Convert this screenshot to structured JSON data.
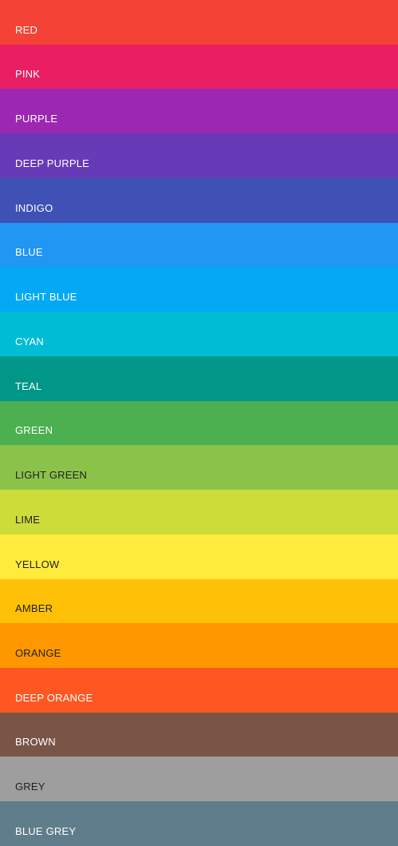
{
  "palette": {
    "items": [
      {
        "label": "RED",
        "color": "#F44336",
        "text_color": "#FFFFFF"
      },
      {
        "label": "PINK",
        "color": "#E91E63",
        "text_color": "#FFFFFF"
      },
      {
        "label": "PURPLE",
        "color": "#9C27B0",
        "text_color": "#FFFFFF"
      },
      {
        "label": "DEEP PURPLE",
        "color": "#673AB7",
        "text_color": "#FFFFFF"
      },
      {
        "label": "INDIGO",
        "color": "#3F51B5",
        "text_color": "#FFFFFF"
      },
      {
        "label": "BLUE",
        "color": "#2196F3",
        "text_color": "#FFFFFF"
      },
      {
        "label": "LIGHT BLUE",
        "color": "#03A9F4",
        "text_color": "#FFFFFF"
      },
      {
        "label": "CYAN",
        "color": "#00BCD4",
        "text_color": "#FFFFFF"
      },
      {
        "label": "TEAL",
        "color": "#009688",
        "text_color": "#FFFFFF"
      },
      {
        "label": "GREEN",
        "color": "#4CAF50",
        "text_color": "#FFFFFF"
      },
      {
        "label": "LIGHT GREEN",
        "color": "#8BC34A",
        "text_color": "#212121"
      },
      {
        "label": "LIME",
        "color": "#CDDC39",
        "text_color": "#212121"
      },
      {
        "label": "YELLOW",
        "color": "#FFEB3B",
        "text_color": "#212121"
      },
      {
        "label": "AMBER",
        "color": "#FFC107",
        "text_color": "#212121"
      },
      {
        "label": "ORANGE",
        "color": "#FF9800",
        "text_color": "#212121"
      },
      {
        "label": "DEEP ORANGE",
        "color": "#FF5722",
        "text_color": "#FFFFFF"
      },
      {
        "label": "BROWN",
        "color": "#795548",
        "text_color": "#FFFFFF"
      },
      {
        "label": "GREY",
        "color": "#9E9E9E",
        "text_color": "#212121"
      },
      {
        "label": "BLUE GREY",
        "color": "#607D8B",
        "text_color": "#FFFFFF"
      }
    ]
  }
}
